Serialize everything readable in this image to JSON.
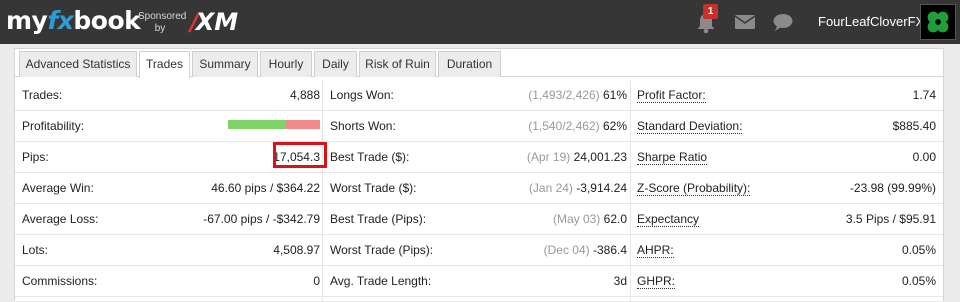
{
  "header": {
    "logo_parts": [
      "my",
      "fx",
      "book"
    ],
    "sponsored_line1": "Sponsored",
    "sponsored_line2": "by",
    "sponsor": "XM",
    "notification_count": "1",
    "username": "FourLeafCloverFX"
  },
  "tabs": [
    {
      "label": "Advanced Statistics",
      "active": false
    },
    {
      "label": "Trades",
      "active": true
    },
    {
      "label": "Summary",
      "active": false
    },
    {
      "label": "Hourly",
      "active": false
    },
    {
      "label": "Daily",
      "active": false
    },
    {
      "label": "Risk of Ruin",
      "active": false
    },
    {
      "label": "Duration",
      "active": false
    }
  ],
  "stats": {
    "col1": [
      {
        "label": "Trades:",
        "value": "4,888"
      },
      {
        "label": "Profitability:",
        "value": ""
      },
      {
        "label": "Pips:",
        "value": "17,054.3"
      },
      {
        "label": "Average Win:",
        "value": "46.60 pips / $364.22"
      },
      {
        "label": "Average Loss:",
        "value": "-67.00 pips / -$342.79"
      },
      {
        "label": "Lots:",
        "value": "4,508.97"
      },
      {
        "label": "Commissions:",
        "value": "0"
      }
    ],
    "col2": [
      {
        "label": "Longs Won:",
        "muted": "(1,493/2,426)",
        "value": "61%"
      },
      {
        "label": "Shorts Won:",
        "muted": "(1,540/2,462)",
        "value": "62%"
      },
      {
        "label": "Best Trade ($):",
        "muted": "(Apr 19)",
        "value": "24,001.23"
      },
      {
        "label": "Worst Trade ($):",
        "muted": "(Jan 24)",
        "value": "-3,914.24"
      },
      {
        "label": "Best Trade (Pips):",
        "muted": "(May 03)",
        "value": "62.0"
      },
      {
        "label": "Worst Trade (Pips):",
        "muted": "(Dec 04)",
        "value": "-386.4"
      },
      {
        "label": "Avg. Trade Length:",
        "muted": "",
        "value": "3d"
      }
    ],
    "col3": [
      {
        "label": "Profit Factor:",
        "value": "1.74"
      },
      {
        "label": "Standard Deviation:",
        "value": "$885.40"
      },
      {
        "label": "Sharpe Ratio",
        "value": "0.00"
      },
      {
        "label": "Z-Score (Probability):",
        "value": "-23.98 (99.99%)"
      },
      {
        "label": "Expectancy",
        "value": "3.5 Pips / $95.91"
      },
      {
        "label": "AHPR:",
        "value": "0.05%"
      },
      {
        "label": "GHPR:",
        "value": "0.05%"
      }
    ]
  },
  "profitability": {
    "win_fraction": 0.62,
    "win_color": "#7fd468",
    "loss_color": "#f08a8a"
  },
  "colors": {
    "topbar": "#363636",
    "logo_fx": "#2f9bd6",
    "badge": "#c9302c",
    "highlight": "#d6131b"
  }
}
